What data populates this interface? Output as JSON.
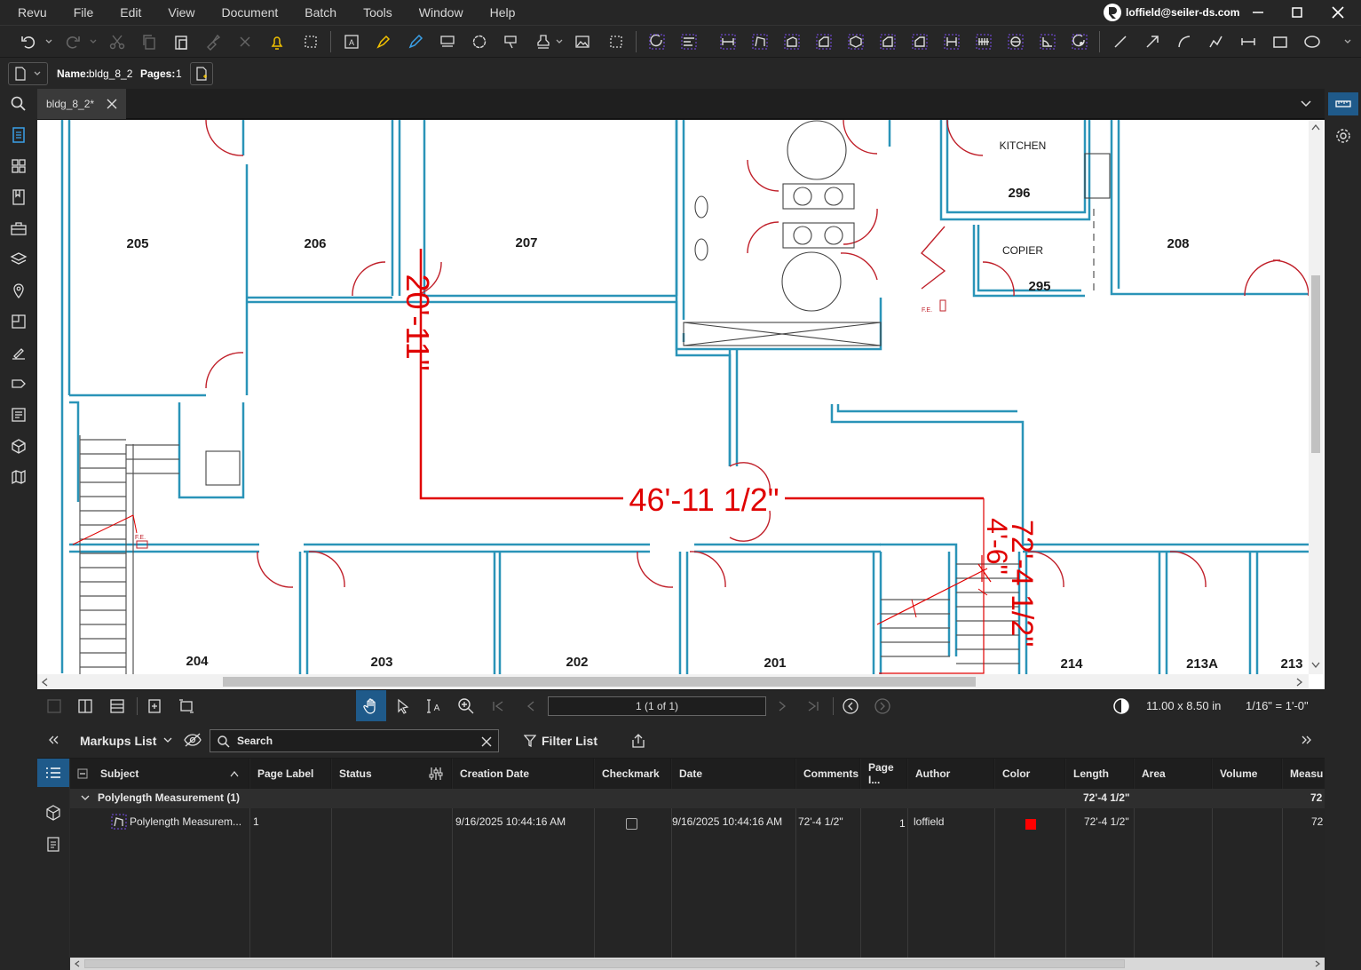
{
  "menubar": {
    "items": [
      "Revu",
      "File",
      "Edit",
      "View",
      "Document",
      "Batch",
      "Tools",
      "Window",
      "Help"
    ],
    "account": "loffield@seiler-ds.com"
  },
  "docbar": {
    "name_label": "Name:",
    "name_value": "bldg_8_2",
    "pages_label": "Pages:",
    "pages_value": "1"
  },
  "tab": {
    "title": "bldg_8_2*"
  },
  "drawing": {
    "rooms": [
      "205",
      "206",
      "207",
      "296",
      "208",
      "295",
      "204",
      "203",
      "202",
      "201",
      "214",
      "213A",
      "213"
    ],
    "labels": [
      "KITCHEN",
      "COPIER",
      "F.E."
    ],
    "measurements": {
      "vertical": "20'-11\"",
      "horizontal": "46'-11 1/2\"",
      "diag_total": "72'-4 1/2\"",
      "diag_segment": "4'-6\""
    },
    "accent_color": "#e00000",
    "wall_color": "#2a94b8"
  },
  "statusbar": {
    "page_indicator": "1 (1 of 1)",
    "page_size": "11.00 x 8.50 in",
    "scale": "1/16\" = 1'-0\""
  },
  "markups": {
    "title": "Markups List",
    "search_placeholder": "Search",
    "filter_label": "Filter List",
    "columns": [
      "Subject",
      "Page Label",
      "Status",
      "Creation Date",
      "Checkmark",
      "Date",
      "Comments",
      "Page I...",
      "Author",
      "Color",
      "Length",
      "Area",
      "Volume",
      "Measu"
    ],
    "group": {
      "label": "Polylength Measurement (1)",
      "length": "72'-4 1/2\"",
      "measure": "72"
    },
    "rows": [
      {
        "subject": "Polylength Measurem...",
        "page_label": "1",
        "status": "",
        "creation_date": "9/16/2025 10:44:16 AM",
        "date": "9/16/2025 10:44:16 AM",
        "comments": "72'-4 1/2\"",
        "page_index": "1",
        "author": "loffield",
        "color": "#ff0000",
        "length": "72'-4 1/2\"",
        "measure": "72"
      }
    ]
  }
}
